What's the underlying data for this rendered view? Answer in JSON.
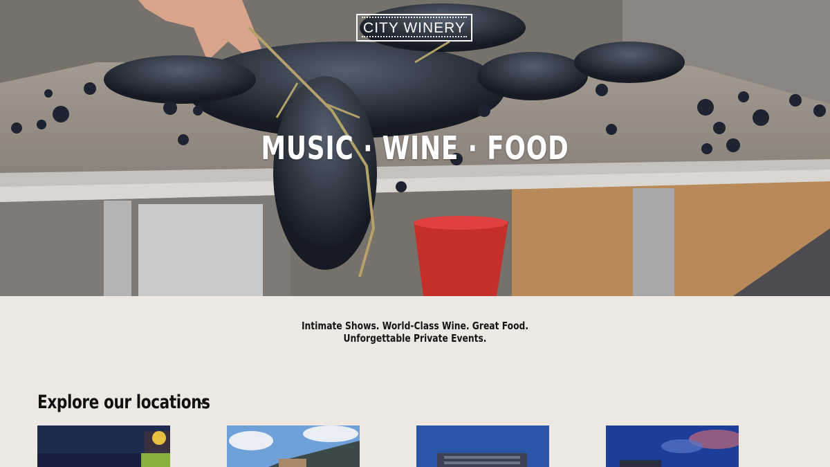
{
  "brand": {
    "logo_text": "CITY WINERY"
  },
  "hero": {
    "tagline": "MUSIC · WINE · FOOD"
  },
  "intro": {
    "line1": "Intimate Shows. World-Class Wine. Great Food.",
    "line2": "Unforgettable Private Events."
  },
  "locations": {
    "heading": "Explore our locations",
    "toggle_icon": "chevron-down-icon",
    "cards": [
      {
        "image": "night-venue-photo"
      },
      {
        "image": "sky-building-photo"
      },
      {
        "image": "dusk-building-photo"
      },
      {
        "image": "blue-sky-building-photo"
      }
    ]
  },
  "colors": {
    "page_background": "#ede8e2",
    "text": "#111111",
    "overlay_text": "#ffffff"
  }
}
